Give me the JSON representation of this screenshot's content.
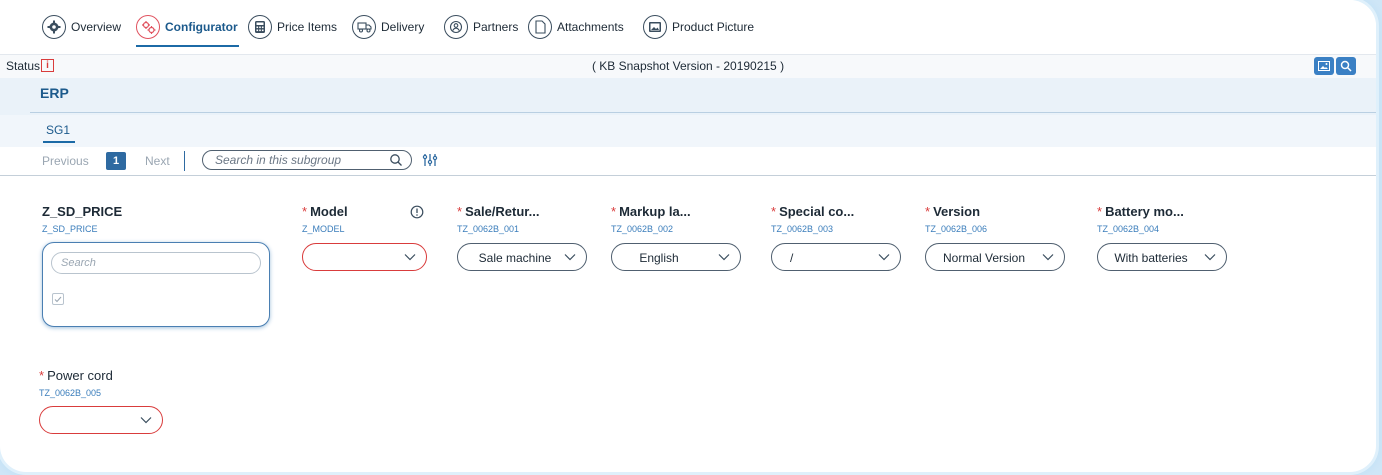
{
  "tabs": [
    {
      "label": "Overview",
      "icon": "gear-icon"
    },
    {
      "label": "Configurator",
      "icon": "configurator-icon"
    },
    {
      "label": "Price Items",
      "icon": "calculator-icon"
    },
    {
      "label": "Delivery",
      "icon": "truck-icon"
    },
    {
      "label": "Partners",
      "icon": "partners-icon"
    },
    {
      "label": "Attachments",
      "icon": "document-icon"
    },
    {
      "label": "Product Picture",
      "icon": "picture-icon"
    }
  ],
  "active_tab": "Configurator",
  "status": {
    "label": "Status",
    "info_glyph": "i",
    "snapshot": "( KB Snapshot Version - 20190215 )"
  },
  "group": {
    "title": "ERP",
    "subgroup": "SG1"
  },
  "pager": {
    "previous": "Previous",
    "page": "1",
    "next": "Next",
    "search_placeholder": "Search in this subgroup"
  },
  "fields": {
    "z_sd_price": {
      "label": "Z_SD_PRICE",
      "tech": "Z_SD_PRICE",
      "search_placeholder": "Search"
    },
    "model": {
      "label": "Model",
      "tech": "Z_MODEL",
      "value": ""
    },
    "sale": {
      "label": "Sale/Retur...",
      "tech": "TZ_0062B_001",
      "value": "Sale machine"
    },
    "markup": {
      "label": "Markup la...",
      "tech": "TZ_0062B_002",
      "value": "English"
    },
    "special": {
      "label": "Special co...",
      "tech": "TZ_0062B_003",
      "value": "/"
    },
    "version": {
      "label": "Version",
      "tech": "TZ_0062B_006",
      "value": "Normal Version"
    },
    "battery": {
      "label": "Battery mo...",
      "tech": "TZ_0062B_004",
      "value": "With batteries"
    },
    "power": {
      "label": "Power cord",
      "tech": "TZ_0062B_005",
      "value": ""
    }
  },
  "required_marker": "*",
  "colors": {
    "accent": "#1c5a8c",
    "required": "#d93c3c",
    "button": "#3a80c4"
  }
}
